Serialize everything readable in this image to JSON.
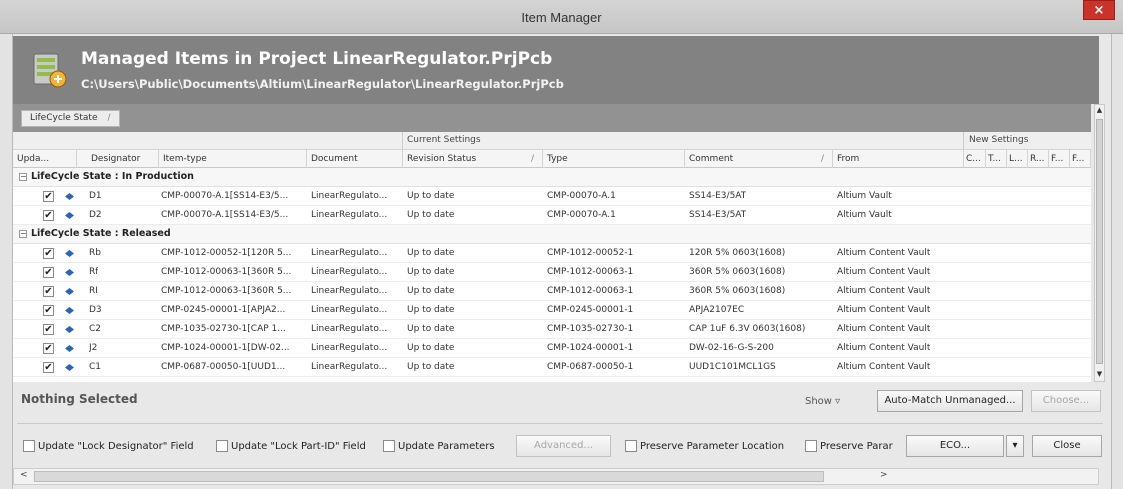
{
  "window": {
    "title": "Item Manager",
    "close_glyph": "×"
  },
  "header": {
    "icon": "database-server-icon",
    "title": "Managed Items in Project LinearRegulator.PrjPcb",
    "path": "C:\\Users\\Public\\Documents\\Altium\\LinearRegulator\\LinearRegulator.PrjPcb"
  },
  "grouping": {
    "tag": "LifeCycle State",
    "tag_sep": "/"
  },
  "bands": {
    "current": "Current Settings",
    "new": "New Settings"
  },
  "columns": {
    "update": "Upda...",
    "designator": "Designator",
    "item_type": "Item-type",
    "document": "Document",
    "revision_status": "Revision Status",
    "type": "Type",
    "comment": "Comment",
    "from": "From",
    "sort_glyph": "/",
    "new_c": "C...",
    "new_t": "T...",
    "new_l": "L...",
    "new_r": "R...",
    "new_f1": "F...",
    "new_f2": "F..."
  },
  "groups": [
    {
      "label": "LifeCycle State : In Production",
      "toggle": "−",
      "rows": [
        {
          "checked": "✔",
          "designator": "D1",
          "item_type": "CMP-00070-A.1[SS14-E3/5...",
          "document": "LinearRegulato...",
          "revision_status": "Up to date",
          "type": "CMP-00070-A.1",
          "comment": "SS14-E3/5AT",
          "from": "Altium Vault"
        },
        {
          "checked": "✔",
          "designator": "D2",
          "item_type": "CMP-00070-A.1[SS14-E3/5...",
          "document": "LinearRegulato...",
          "revision_status": "Up to date",
          "type": "CMP-00070-A.1",
          "comment": "SS14-E3/5AT",
          "from": "Altium Vault"
        }
      ]
    },
    {
      "label": "LifeCycle State : Released",
      "toggle": "−",
      "rows": [
        {
          "checked": "✔",
          "designator": "Rb",
          "item_type": "CMP-1012-00052-1[120R 5...",
          "document": "LinearRegulato...",
          "revision_status": "Up to date",
          "type": "CMP-1012-00052-1",
          "comment": "120R 5% 0603(1608)",
          "from": "Altium Content Vault"
        },
        {
          "checked": "✔",
          "designator": "Rf",
          "item_type": "CMP-1012-00063-1[360R 5...",
          "document": "LinearRegulato...",
          "revision_status": "Up to date",
          "type": "CMP-1012-00063-1",
          "comment": "360R 5% 0603(1608)",
          "from": "Altium Content Vault"
        },
        {
          "checked": "✔",
          "designator": "RI",
          "item_type": "CMP-1012-00063-1[360R 5...",
          "document": "LinearRegulato...",
          "revision_status": "Up to date",
          "type": "CMP-1012-00063-1",
          "comment": "360R 5% 0603(1608)",
          "from": "Altium Content Vault"
        },
        {
          "checked": "✔",
          "designator": "D3",
          "item_type": "CMP-0245-00001-1[APJA2...",
          "document": "LinearRegulato...",
          "revision_status": "Up to date",
          "type": "CMP-0245-00001-1",
          "comment": "APJA2107EC",
          "from": "Altium Content Vault"
        },
        {
          "checked": "✔",
          "designator": "C2",
          "item_type": "CMP-1035-02730-1[CAP 1...",
          "document": "LinearRegulato...",
          "revision_status": "Up to date",
          "type": "CMP-1035-02730-1",
          "comment": "CAP 1uF 6.3V 0603(1608)",
          "from": "Altium Content Vault"
        },
        {
          "checked": "✔",
          "designator": "J2",
          "item_type": "CMP-1024-00001-1[DW-02...",
          "document": "LinearRegulato...",
          "revision_status": "Up to date",
          "type": "CMP-1024-00001-1",
          "comment": "DW-02-16-G-S-200",
          "from": "Altium Content Vault"
        },
        {
          "checked": "✔",
          "designator": "C1",
          "item_type": "CMP-0687-00050-1[UUD1...",
          "document": "LinearRegulato...",
          "revision_status": "Up to date",
          "type": "CMP-0687-00050-1",
          "comment": "UUD1C101MCL1GS",
          "from": "Altium Content Vault"
        }
      ]
    }
  ],
  "footer": {
    "status": "Nothing Selected",
    "show_label": "Show ▿",
    "auto_match": "Auto-Match Unmanaged...",
    "choose": "Choose...",
    "opt_lock_designator": "Update \"Lock Designator\" Field",
    "opt_lock_partid": "Update \"Lock Part-ID\" Field",
    "opt_update_params": "Update Parameters",
    "advanced": "Advanced...",
    "opt_preserve_location": "Preserve Parameter Location",
    "opt_preserve_param": "Preserve Parar",
    "eco": "ECO...",
    "eco_arrow": "▾",
    "close": "Close"
  },
  "scroll": {
    "left": "<",
    "right": ">",
    "up": "▲",
    "down": "▼"
  },
  "colors": {
    "header_bg": "#828282",
    "diamond": "#2f64b5",
    "close_red": "#c8342b"
  }
}
